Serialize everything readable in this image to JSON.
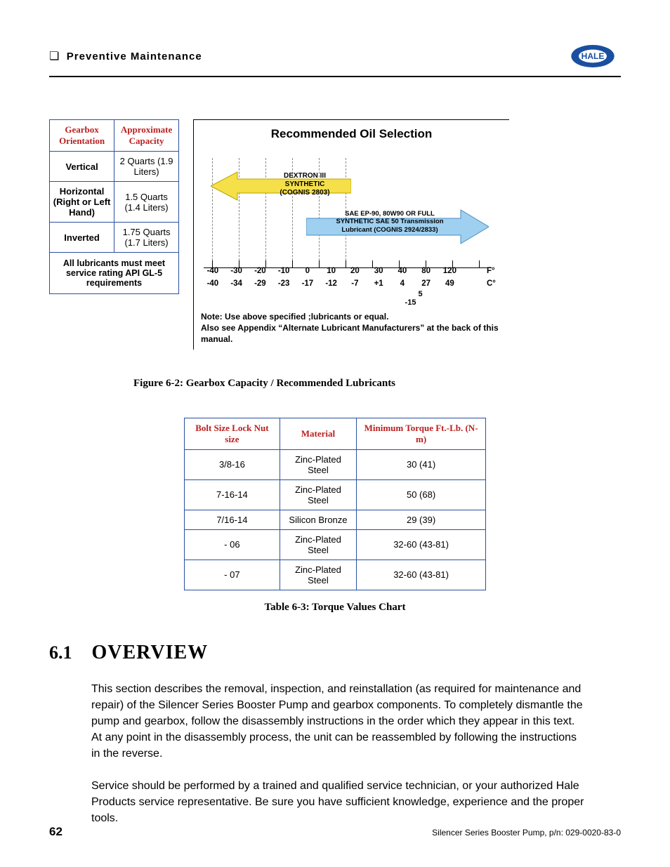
{
  "header": {
    "title": "Preventive Maintenance",
    "logo_text": "HALE"
  },
  "gearbox_table": {
    "headers": [
      "Gearbox Orientation",
      "Approximate Capacity"
    ],
    "rows": [
      {
        "orientation": "Vertical",
        "capacity": "2 Quarts (1.9 Liters)"
      },
      {
        "orientation": "Horizontal (Right or Left Hand)",
        "capacity": "1.5 Quarts (1.4 Liters)"
      },
      {
        "orientation": "Inverted",
        "capacity": "1.75 Quarts (1.7 Liters)"
      }
    ],
    "note": "All lubricants must meet service rating API GL-5 requirements"
  },
  "chart_data": {
    "type": "range-bar",
    "title": "Recommended Oil Selection",
    "x_units": [
      "F°",
      "C°"
    ],
    "f_ticks": [
      "-40",
      "-30",
      "-20",
      "-10",
      "0",
      "10",
      "20",
      "30",
      "40",
      "80",
      "120"
    ],
    "c_ticks": [
      "-40",
      "-34",
      "-29",
      "-23",
      "-17",
      "-12",
      "-7",
      "+1",
      "4",
      "27",
      "49"
    ],
    "sub_markers": {
      "f_at_5": "5",
      "c_at_neg15": "-15"
    },
    "series": [
      {
        "name": "DEXTRON III SYNTHETIC (COGNIS 2803)",
        "direction": "left",
        "range_f": [
          -40,
          5
        ],
        "color": "#f5e04a"
      },
      {
        "name": "SAE EP-90, 80W90 OR FULL SYNTHETIC SAE 50 Transmission Lubricant (COGNIS 2924/2833)",
        "direction": "right",
        "range_f": [
          -15,
          120
        ],
        "color": "#6fb6e8"
      }
    ],
    "notes": [
      "Note:  Use above specified ;lubricants or equal.",
      "Also see Appendix “Alternate Lubricant Manufacturers” at the back of this manual."
    ]
  },
  "figure_caption": "Figure 6-2: Gearbox Capacity / Recommended Lubricants",
  "torque_table": {
    "headers": [
      "Bolt Size Lock Nut size",
      "Material",
      "Minimum Torque Ft.-Lb. (N-m)"
    ],
    "rows": [
      {
        "size": "3/8-16",
        "material": "Zinc-Plated Steel",
        "torque": "30 (41)"
      },
      {
        "size": "7-16-14",
        "material": "Zinc-Plated Steel",
        "torque": "50 (68)"
      },
      {
        "size": "7/16-14",
        "material": "Silicon Bronze",
        "torque": "29 (39)"
      },
      {
        "size": "- 06",
        "material": "Zinc-Plated Steel",
        "torque": "32-60 (43-81)"
      },
      {
        "size": "- 07",
        "material": "Zinc-Plated Steel",
        "torque": "32-60 (43-81)"
      }
    ],
    "caption": "Table 6-3: Torque Values Chart"
  },
  "section": {
    "number": "6.1",
    "title": "OVERVIEW",
    "paragraphs": [
      "This section describes the removal, inspection, and reinstallation (as required for maintenance and repair) of the Silencer Series Booster Pump and gearbox components.  To completely dismantle the pump and gearbox, follow the disassembly instructions in the order which they appear in this text.  At any point in the disassembly process, the unit can be reassembled by following the instructions in the reverse.",
      "Service should be performed by a trained and qualified service technician, or your authorized Hale Products service representative.  Be sure you have sufficient knowledge, experience and the proper tools."
    ]
  },
  "footer": {
    "page_number": "62",
    "doc_info": "Silencer Series Booster Pump, p/n: 029-0020-83-0"
  }
}
